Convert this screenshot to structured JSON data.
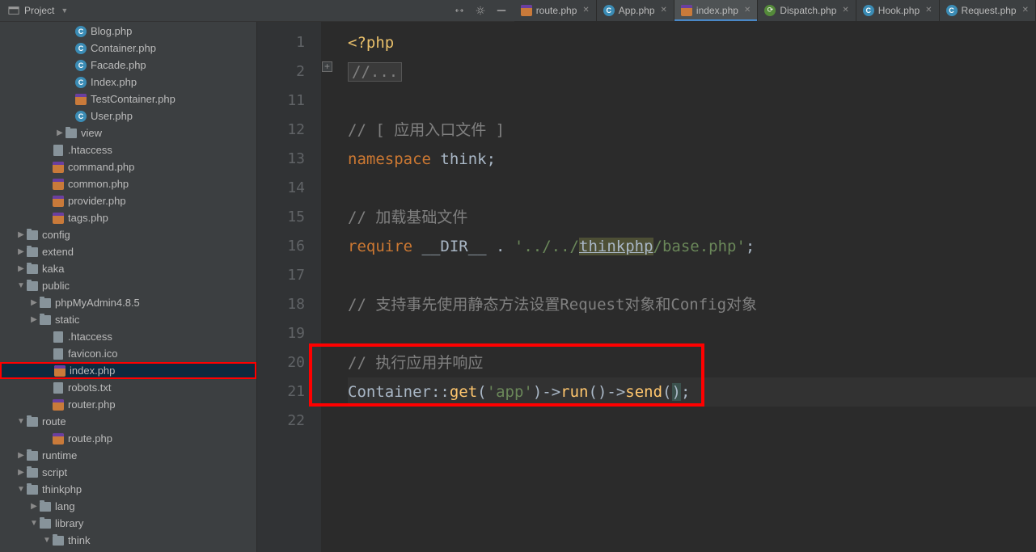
{
  "header": {
    "project_label": "Project"
  },
  "tabs": [
    {
      "icon": "php-p",
      "label": "route.php",
      "active": false
    },
    {
      "icon": "php-c",
      "label": "App.php",
      "active": false
    },
    {
      "icon": "php-p",
      "label": "index.php",
      "active": true
    },
    {
      "icon": "dispatch",
      "label": "Dispatch.php",
      "active": false
    },
    {
      "icon": "php-c",
      "label": "Hook.php",
      "active": false
    },
    {
      "icon": "php-c",
      "label": "Request.php",
      "active": false
    }
  ],
  "tree": [
    {
      "indent": 80,
      "arrow": "",
      "icon": "php-c",
      "label": "Blog.php"
    },
    {
      "indent": 80,
      "arrow": "",
      "icon": "php-c",
      "label": "Container.php"
    },
    {
      "indent": 80,
      "arrow": "",
      "icon": "php-c",
      "label": "Facade.php"
    },
    {
      "indent": 80,
      "arrow": "",
      "icon": "php-c",
      "label": "Index.php"
    },
    {
      "indent": 80,
      "arrow": "",
      "icon": "php-p",
      "label": "TestContainer.php"
    },
    {
      "indent": 80,
      "arrow": "",
      "icon": "php-c",
      "label": "User.php"
    },
    {
      "indent": 68,
      "arrow": "▶",
      "icon": "folder",
      "label": "view"
    },
    {
      "indent": 52,
      "arrow": "",
      "icon": "file",
      ".label": "",
      "label": ".htaccess"
    },
    {
      "indent": 52,
      "arrow": "",
      "icon": "php-p",
      "label": "command.php"
    },
    {
      "indent": 52,
      "arrow": "",
      "icon": "php-p",
      "label": "common.php"
    },
    {
      "indent": 52,
      "arrow": "",
      "icon": "php-p",
      "label": "provider.php"
    },
    {
      "indent": 52,
      "arrow": "",
      "icon": "php-p",
      "label": "tags.php"
    },
    {
      "indent": 20,
      "arrow": "▶",
      "icon": "folder",
      "label": "config"
    },
    {
      "indent": 20,
      "arrow": "▶",
      "icon": "folder",
      "label": "extend"
    },
    {
      "indent": 20,
      "arrow": "▶",
      "icon": "folder",
      "label": "kaka"
    },
    {
      "indent": 20,
      "arrow": "▼",
      "icon": "folder",
      "label": "public"
    },
    {
      "indent": 36,
      "arrow": "▶",
      "icon": "folder",
      "label": "phpMyAdmin4.8.5"
    },
    {
      "indent": 36,
      "arrow": "▶",
      "icon": "folder",
      "label": "static"
    },
    {
      "indent": 52,
      "arrow": "",
      "icon": "file",
      "label": ".htaccess"
    },
    {
      "indent": 52,
      "arrow": "",
      "icon": "file",
      "label": "favicon.ico"
    },
    {
      "indent": 52,
      "arrow": "",
      "icon": "php-p",
      "label": "index.php",
      "selected": true
    },
    {
      "indent": 52,
      "arrow": "",
      "icon": "file",
      "label": "robots.txt"
    },
    {
      "indent": 52,
      "arrow": "",
      "icon": "php-p",
      "label": "router.php"
    },
    {
      "indent": 20,
      "arrow": "▼",
      "icon": "folder",
      "label": "route"
    },
    {
      "indent": 52,
      "arrow": "",
      "icon": "php-p",
      "label": "route.php"
    },
    {
      "indent": 20,
      "arrow": "▶",
      "icon": "folder",
      "label": "runtime"
    },
    {
      "indent": 20,
      "arrow": "▶",
      "icon": "folder",
      "label": "script"
    },
    {
      "indent": 20,
      "arrow": "▼",
      "icon": "folder",
      "label": "thinkphp"
    },
    {
      "indent": 36,
      "arrow": "▶",
      "icon": "folder",
      "label": "lang"
    },
    {
      "indent": 36,
      "arrow": "▼",
      "icon": "folder",
      "label": "library"
    },
    {
      "indent": 52,
      "arrow": "▼",
      "icon": "folder",
      "label": "think"
    }
  ],
  "line_numbers": [
    "1",
    "2",
    "11",
    "12",
    "13",
    "14",
    "15",
    "16",
    "17",
    "18",
    "19",
    "20",
    "21",
    "22"
  ],
  "code": {
    "l1_tag": "<?php",
    "l2_fold": "//...",
    "l12_com": "// [ 应用入口文件 ]",
    "l13_kw": "namespace",
    "l13_ns": " think",
    "l13_sc": ";",
    "l15_com": "// 加载基础文件",
    "l16_kw": "require ",
    "l16_dir": "__DIR__",
    "l16_op": " . ",
    "l16_s1": "'../../",
    "l16_link": "thinkphp",
    "l16_s2": "/base.php'",
    "l16_sc": ";",
    "l18_com": "// 支持事先使用静态方法设置Request对象和Config对象",
    "l20_com": "// 执行应用并响应",
    "l21_cls": "Container",
    "l21_cc": "::",
    "l21_get": "get",
    "l21_p1": "(",
    "l21_arg": "'app'",
    "l21_p2": ")",
    "l21_arr1": "->",
    "l21_run": "run",
    "l21_p3": "()",
    "l21_arr2": "->",
    "l21_send": "send",
    "l21_p4": "(",
    "l21_p5": ")",
    "l21_sc": ";"
  }
}
